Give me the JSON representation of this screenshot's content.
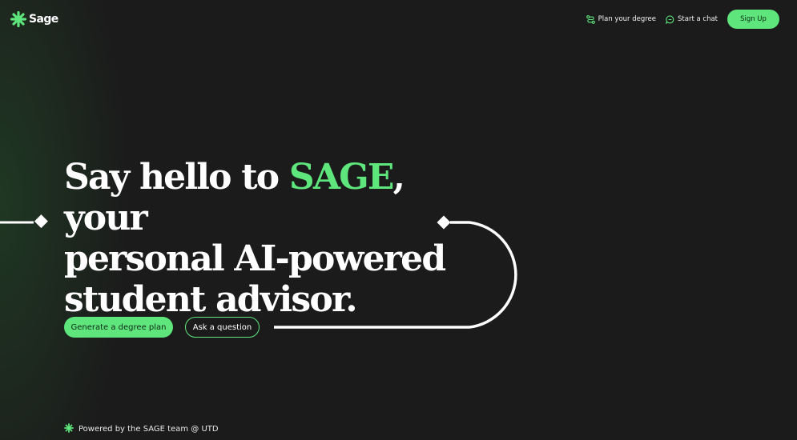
{
  "header": {
    "logo_text": "Sage",
    "logo_icon": "asterisk-logo-icon",
    "nav": [
      {
        "label": "Plan your degree",
        "icon": "route-icon"
      },
      {
        "label": "Start a chat",
        "icon": "chat-bubble-icon"
      }
    ],
    "signup_label": "Sign Up"
  },
  "hero": {
    "line1_a": "Say hello to ",
    "line1_highlight": "SAGE",
    "line1_b": ", your",
    "line2": "personal AI-powered",
    "line3": "student advisor."
  },
  "actions": {
    "primary_label": "Generate a degree plan",
    "secondary_label": "Ask a question"
  },
  "footer": {
    "icon": "asterisk-icon",
    "text": "Powered by the SAGE team @ UTD"
  },
  "colors": {
    "background": "#1b1b1b",
    "accent": "#5ee67d",
    "text": "#ffffff"
  }
}
